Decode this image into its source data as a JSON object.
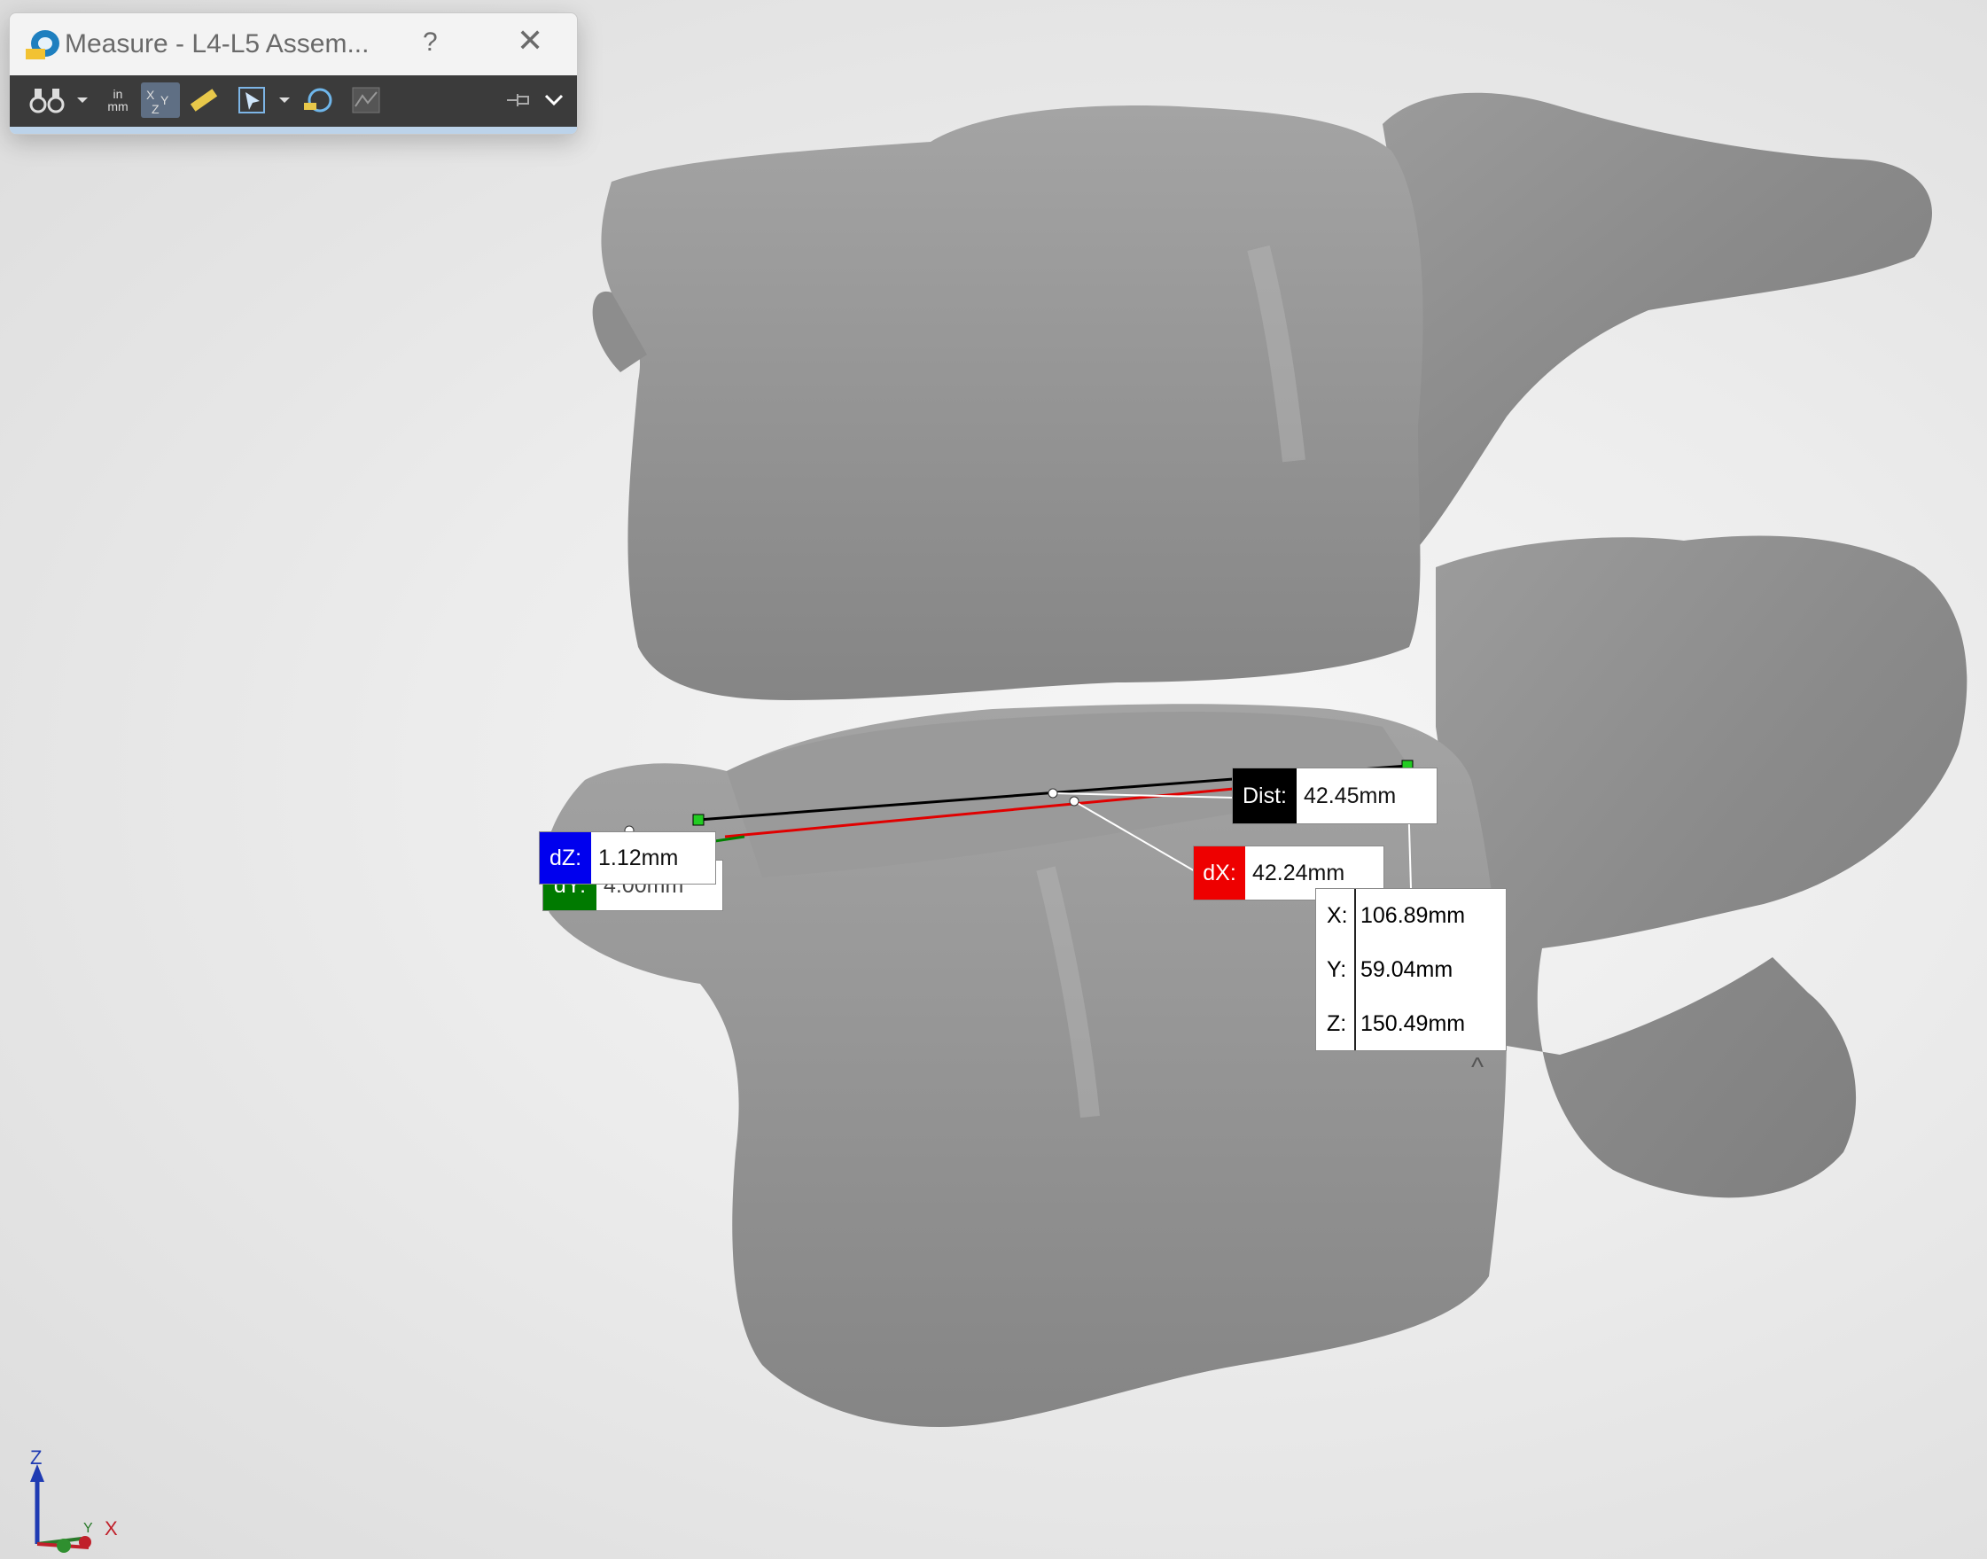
{
  "dialog": {
    "title": "Measure - L4-L5 Assem...",
    "help": "?",
    "close": "✕",
    "toolbar": {
      "arc_circle_tooltip": "Arc/Circle Measurements",
      "units_top": "in",
      "units_bottom": "mm",
      "xyz_label": "XYZ",
      "point_to_point": "Point-to-Point",
      "select": "Select",
      "history": "Measurement History",
      "sensor": "Create Sensor",
      "pin": "Keep Visible",
      "expand": "Expand"
    }
  },
  "measurements": {
    "dist": {
      "key": "Dist:",
      "value": "42.45mm",
      "color": "#000000"
    },
    "dx": {
      "key": "dX:",
      "value": "42.24mm",
      "color": "#ee0000"
    },
    "dz": {
      "key": "dZ:",
      "value": "1.12mm",
      "color": "#0000ee"
    },
    "dy": {
      "key": "dY:",
      "value": "4.00mm",
      "color": "#007a00"
    },
    "point": {
      "x_key": "X:",
      "x_value": "106.89mm",
      "y_key": "Y:",
      "y_value": "59.04mm",
      "z_key": "Z:",
      "z_value": "150.49mm"
    }
  },
  "triad": {
    "z": "Z",
    "y": "Y",
    "x": "X"
  },
  "colors": {
    "model": "#8f8f8f",
    "background": "#ececec",
    "toolbar": "#3b3b3b"
  }
}
